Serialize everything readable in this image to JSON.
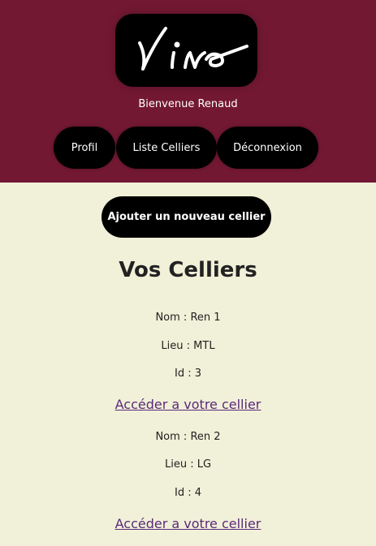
{
  "header": {
    "logo_text": "Vino",
    "welcome": "Bienvenue Renaud",
    "nav": {
      "profil": "Profil",
      "liste_celliers": "Liste Celliers",
      "deconnexion": "Déconnexion"
    }
  },
  "main": {
    "add_button": "Ajouter un nouveau cellier",
    "title": "Vos Celliers",
    "celliers": [
      {
        "nom": "Nom : Ren 1",
        "lieu": "Lieu : MTL",
        "id": "Id : 3",
        "link": "Accéder a votre cellier"
      },
      {
        "nom": "Nom : Ren 2",
        "lieu": "Lieu : LG",
        "id": "Id : 4",
        "link": "Accéder a votre cellier"
      }
    ]
  },
  "colors": {
    "header_bg": "#731833",
    "page_bg": "#f1f0d8",
    "button_bg": "#000000",
    "link": "#5a2a7a"
  }
}
